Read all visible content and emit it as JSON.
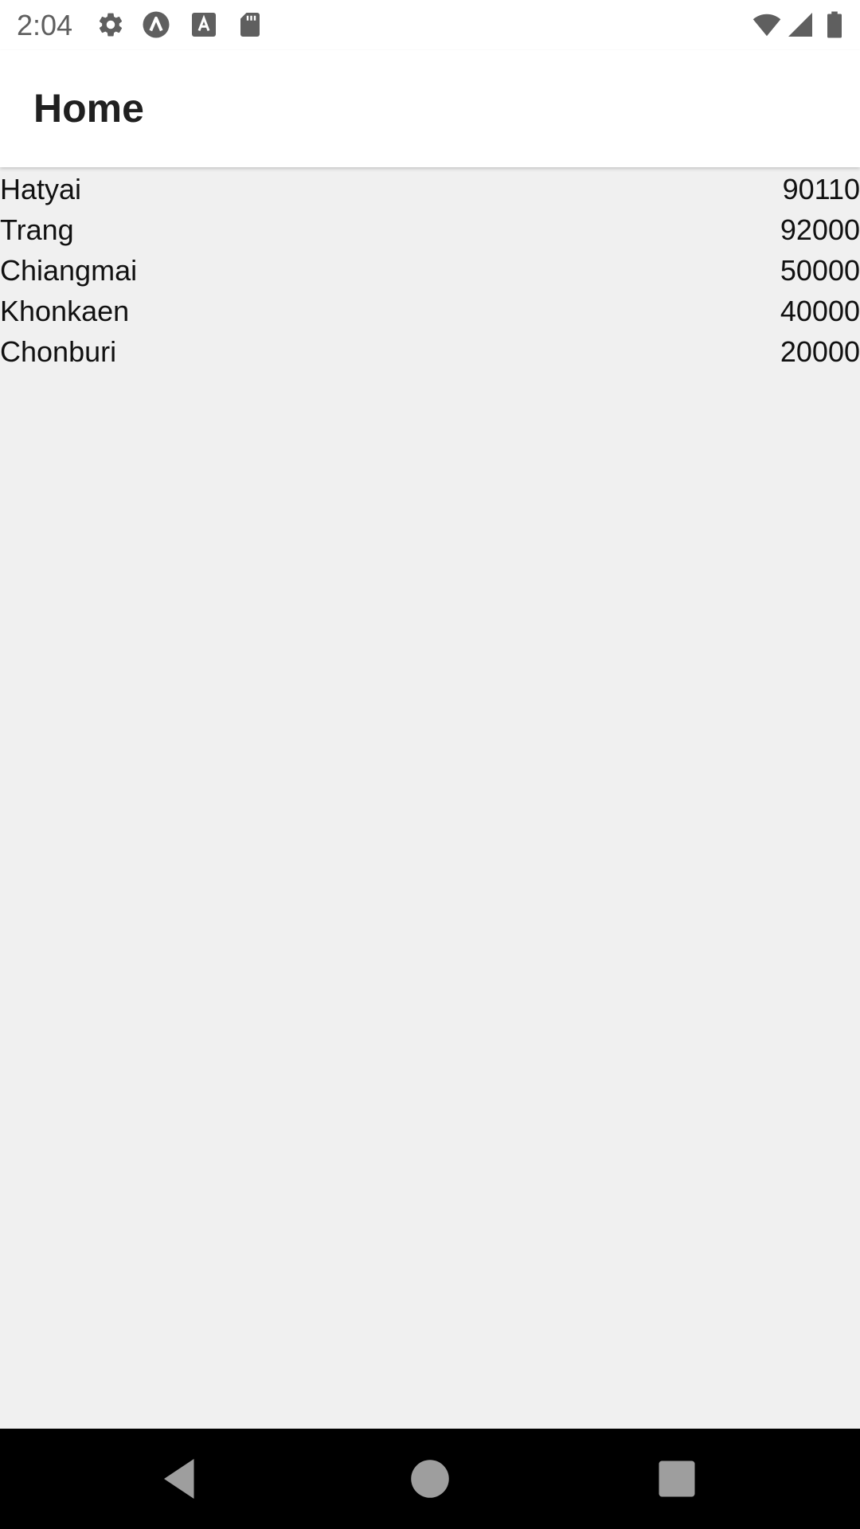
{
  "status_bar": {
    "time": "2:04",
    "left_icons": [
      "gear-icon",
      "a-circle-icon",
      "a-square-icon",
      "sd-card-icon"
    ],
    "right_icons": [
      "wifi-icon",
      "cell-signal-icon",
      "battery-icon"
    ]
  },
  "app_bar": {
    "title": "Home"
  },
  "list": {
    "rows": [
      {
        "name": "Hatyai",
        "code": "90110"
      },
      {
        "name": "Trang",
        "code": "92000"
      },
      {
        "name": "Chiangmai",
        "code": "50000"
      },
      {
        "name": "Khonkaen",
        "code": "40000"
      },
      {
        "name": "Chonburi",
        "code": "20000"
      }
    ]
  },
  "nav_bar": {
    "buttons": [
      "back-icon",
      "home-icon",
      "recents-icon"
    ]
  }
}
